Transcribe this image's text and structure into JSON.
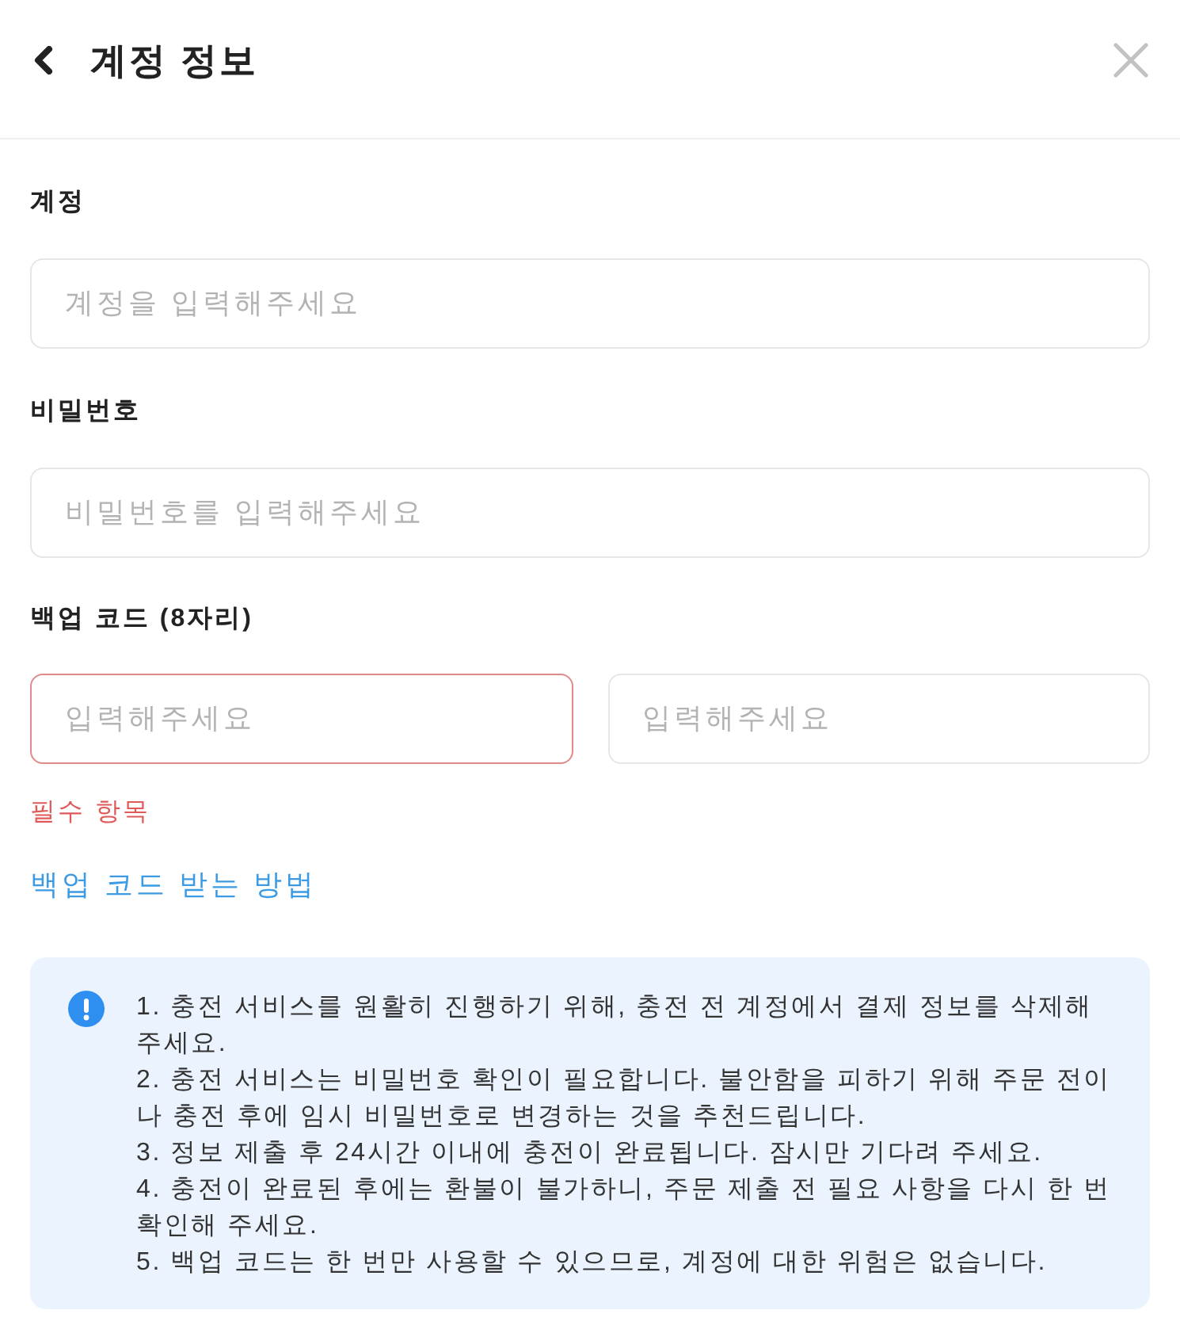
{
  "header": {
    "title": "계정 정보"
  },
  "form": {
    "fields": [
      {
        "label": "계정",
        "placeholder": "계정을 입력해주세요"
      },
      {
        "label": "비밀번호",
        "placeholder": "비밀번호를 입력해주세요"
      }
    ],
    "backup_code": {
      "label": "백업 코드 (8자리)",
      "inputs": [
        {
          "placeholder": "입력해주세요",
          "error": true
        },
        {
          "placeholder": "입력해주세요",
          "error": false
        }
      ],
      "error_message": "필수 항목"
    },
    "help_link": "백업 코드 받는 방법"
  },
  "notice": {
    "items": [
      "1. 충전 서비스를 원활히 진행하기 위해, 충전 전 계정에서 결제 정보를 삭제해 주세요.",
      "2. 충전 서비스는 비밀번호 확인이 필요합니다. 불안함을 피하기 위해 주문 전이나 충전 후에 임시 비밀번호로 변경하는 것을 추천드립니다.",
      "3. 정보 제출 후 24시간 이내에 충전이 완료됩니다. 잠시만 기다려 주세요.",
      "4. 충전이 완료된 후에는 환불이 불가하니, 주문 제출 전 필요 사항을 다시 한 번 확인해 주세요.",
      "5. 백업 코드는 한 번만 사용할 수 있으므로, 계정에 대한 위험은 없습니다."
    ]
  }
}
